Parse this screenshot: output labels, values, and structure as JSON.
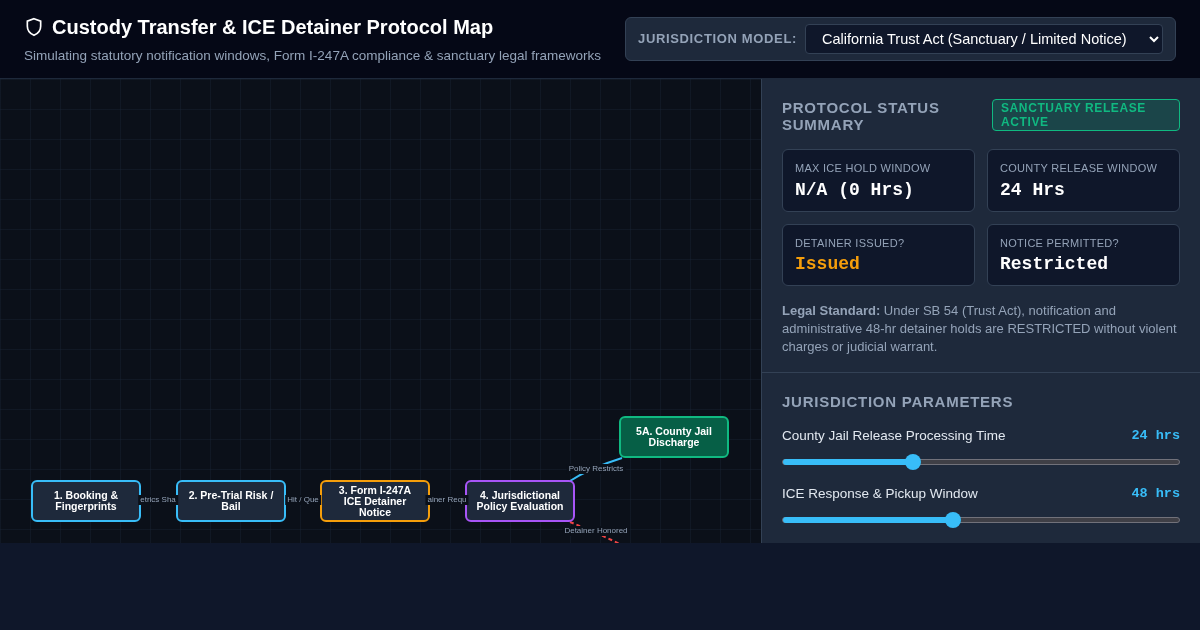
{
  "header": {
    "title": "Custody Transfer & ICE Detainer Protocol Map",
    "subtitle": "Simulating statutory notification windows, Form I-247A compliance & sanctuary legal frameworks",
    "model_label": "JURISDICTION MODEL:",
    "model_value": "California Trust Act (Sanctuary / Limited Notice)"
  },
  "map": {
    "nodes": [
      {
        "label": "1. Booking & Fingerprints",
        "color": "#38bdf8",
        "kind": "step"
      },
      {
        "label": "2. Pre-Trial Risk / Bail",
        "color": "#38bdf8",
        "kind": "step"
      },
      {
        "label": "3. Form I-247A ICE Detainer Notice",
        "color": "#f59e0b",
        "kind": "step"
      },
      {
        "label": "4. Jurisdictional Policy Evaluation",
        "color": "#a855f7",
        "kind": "step"
      },
      {
        "label": "5A. County Jail Discharge",
        "color": "#10b981",
        "kind": "outcome"
      }
    ],
    "edges": [
      {
        "label": "etrics Sha"
      },
      {
        "label": "Hit / Que"
      },
      {
        "label": "ainer Requ"
      },
      {
        "label": "Policy Restricts",
        "color": "#38bdf8"
      },
      {
        "label": "Detainer Honored",
        "color": "#ef4444"
      }
    ]
  },
  "summary": {
    "title": "PROTOCOL STATUS SUMMARY",
    "badge": "SANCTUARY RELEASE ACTIVE",
    "metrics": [
      {
        "label": "MAX ICE HOLD WINDOW",
        "value": "N/A (0 Hrs)",
        "kind": "normal"
      },
      {
        "label": "COUNTY RELEASE WINDOW",
        "value": "24 Hrs",
        "kind": "normal"
      },
      {
        "label": "DETAINER ISSUED?",
        "value": "Issued",
        "kind": "warning"
      },
      {
        "label": "NOTICE PERMITTED?",
        "value": "Restricted",
        "kind": "normal"
      }
    ],
    "legal_note": "**Legal Standard:** Under SB 54 (Trust Act), notification and administrative 48-hr detainer holds are RESTRICTED without violent charges or judicial warrant."
  },
  "parameters": {
    "title": "JURISDICTION PARAMETERS",
    "sliders": [
      {
        "label": "County Jail Release Processing Time",
        "reading": "24 hrs",
        "level": 0.33
      },
      {
        "label": "ICE Response & Pickup Window",
        "reading": "48 hrs",
        "level": 0.43
      }
    ]
  }
}
